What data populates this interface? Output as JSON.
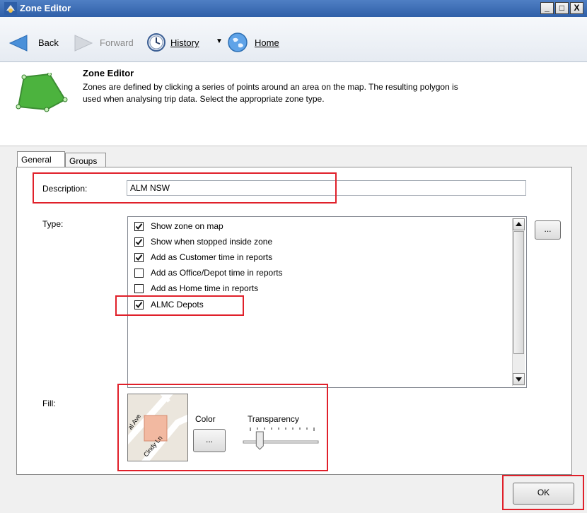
{
  "window": {
    "title": "Zone Editor",
    "controls": {
      "minimize": "_",
      "maximize": "□",
      "close": "X"
    }
  },
  "nav": {
    "back_label": "Back",
    "forward_label": "Forward",
    "history_label": "History",
    "home_label": "Home"
  },
  "header": {
    "title": "Zone Editor",
    "description": "Zones are defined by clicking a series of points around an area on the map. The resulting polygon is used when analysing trip data. Select the appropriate zone type."
  },
  "tabs": [
    {
      "label": "General",
      "active": true
    },
    {
      "label": "Groups",
      "active": false
    }
  ],
  "form": {
    "description_label": "Description:",
    "description_value": "ALM  NSW",
    "type_label": "Type:",
    "type_options": [
      {
        "label": "Show zone on map",
        "checked": true
      },
      {
        "label": "Show when stopped inside zone",
        "checked": true
      },
      {
        "label": "Add as Customer time in reports",
        "checked": true
      },
      {
        "label": "Add as Office/Depot time in reports",
        "checked": false
      },
      {
        "label": "Add as Home time in reports",
        "checked": false
      },
      {
        "label": "ALMC Depots",
        "checked": true
      }
    ],
    "type_more_button": "...",
    "fill_label": "Fill:",
    "color_label": "Color",
    "color_button": "...",
    "transparency_label": "Transparency",
    "transparency_level": 0.22,
    "map_streets": [
      "al Ave",
      "Cindy Ln"
    ]
  },
  "footer": {
    "ok_label": "OK"
  },
  "colors": {
    "highlight_border": "#e0202a",
    "fill_color": "#f2b9a1",
    "titlebar": "#3a6ab5"
  }
}
